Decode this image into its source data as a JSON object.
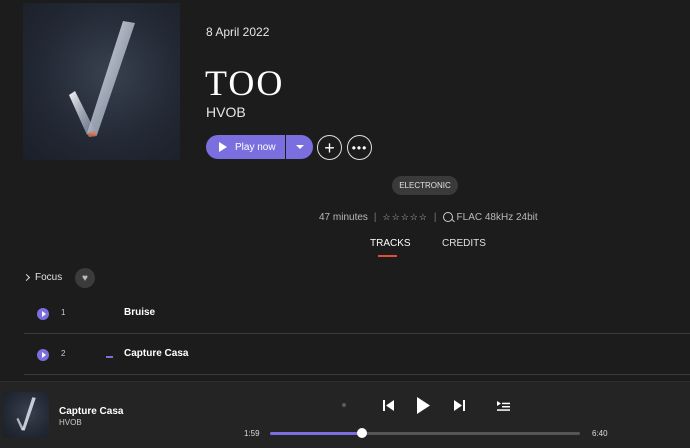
{
  "album": {
    "release_date": "8 April 2022",
    "title": "TOO",
    "artist": "HVOB",
    "genre": "ELECTRONIC",
    "duration": "47 minutes",
    "quality": "FLAC 48kHz 24bit"
  },
  "actions": {
    "play_label": "Play now",
    "add_symbol": "+",
    "more_symbol": "•••"
  },
  "tabs": [
    {
      "label": "TRACKS",
      "active": true
    },
    {
      "label": "CREDITS",
      "active": false
    }
  ],
  "focus": {
    "label": "Focus"
  },
  "tracks": [
    {
      "number": "1",
      "name": "Bruise",
      "playing": false
    },
    {
      "number": "2",
      "name": "Capture Casa",
      "playing": true
    }
  ],
  "player": {
    "title": "Capture Casa",
    "artist": "HVOB",
    "current_time": "1:59",
    "total_time": "6:40",
    "progress": 0.2975
  },
  "colors": {
    "accent": "#7b6fe0",
    "tab_underline": "#d8513f",
    "background": "#1c1c1c"
  },
  "icons": [
    "play-icon",
    "chevron-down-icon",
    "plus-icon",
    "more-icon",
    "star-icon",
    "quality-icon",
    "chevron-right-icon",
    "heart-icon",
    "previous-icon",
    "next-icon",
    "queue-icon"
  ]
}
